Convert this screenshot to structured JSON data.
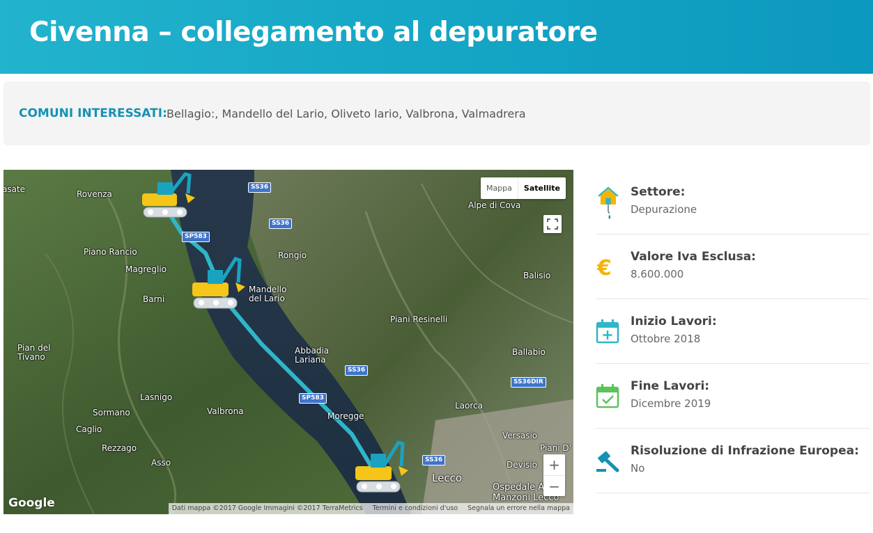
{
  "header": {
    "title": "Civenna – collegamento al depuratore"
  },
  "comuni": {
    "label": "COMUNI INTERESSATI:",
    "value": "Bellagio:, Mandello del Lario, Oliveto lario, Valbrona, Valmadrera"
  },
  "map": {
    "type_buttons": [
      "Mappa",
      "Satellite"
    ],
    "active_type": "Satellite",
    "zoom_in": "+",
    "zoom_out": "−",
    "logo": "Google",
    "attribution": {
      "data": "Dati mappa ©2017 Google Immagini ©2017 TerraMetrics",
      "terms": "Termini e condizioni d'uso",
      "report": "Segnala un errore nella mappa"
    },
    "places": [
      "Rovenza",
      "asate",
      "Piano Rancio",
      "Magreglio",
      "Barni",
      "Pian del Tivano",
      "Lasnigo",
      "Sormano",
      "Caglio",
      "Rezzago",
      "Asso",
      "Valbrona",
      "Rongio",
      "Mandello del Lario",
      "Abbadia Lariana",
      "Piani Resinelli",
      "Alpe di Cova",
      "Balisio",
      "Ballabio",
      "Laorca",
      "Versasio",
      "Piani D'",
      "Devisio",
      "Moregge",
      "Lecco",
      "Ospedale A. Manzoni Lecco"
    ],
    "roads": [
      "SS36",
      "SS36",
      "SP583",
      "SS36",
      "SS36DIR",
      "SP583",
      "SS36"
    ],
    "colors": {
      "route": "#2fb6c9",
      "excavator": "#f5c518",
      "excavator_arm": "#1aa3c0"
    }
  },
  "info": [
    {
      "icon": "house-water-icon",
      "title": "Settore:",
      "value": "Depurazione"
    },
    {
      "icon": "euro-icon",
      "title": "Valore Iva Esclusa:",
      "value": "8.600.000"
    },
    {
      "icon": "calendar-plus-icon",
      "title": "Inizio Lavori:",
      "value": "Ottobre 2018"
    },
    {
      "icon": "calendar-check-icon",
      "title": "Fine Lavori:",
      "value": "Dicembre 2019"
    },
    {
      "icon": "gavel-icon",
      "title": "Risoluzione di Infrazione Europea:",
      "value": "No"
    }
  ],
  "colors": {
    "header": "#13a3c4",
    "accent": "#1592b3",
    "euro": "#f5b400",
    "calendar_start": "#2fb6c9",
    "calendar_end": "#5cc25c",
    "gavel": "#1592b3"
  }
}
